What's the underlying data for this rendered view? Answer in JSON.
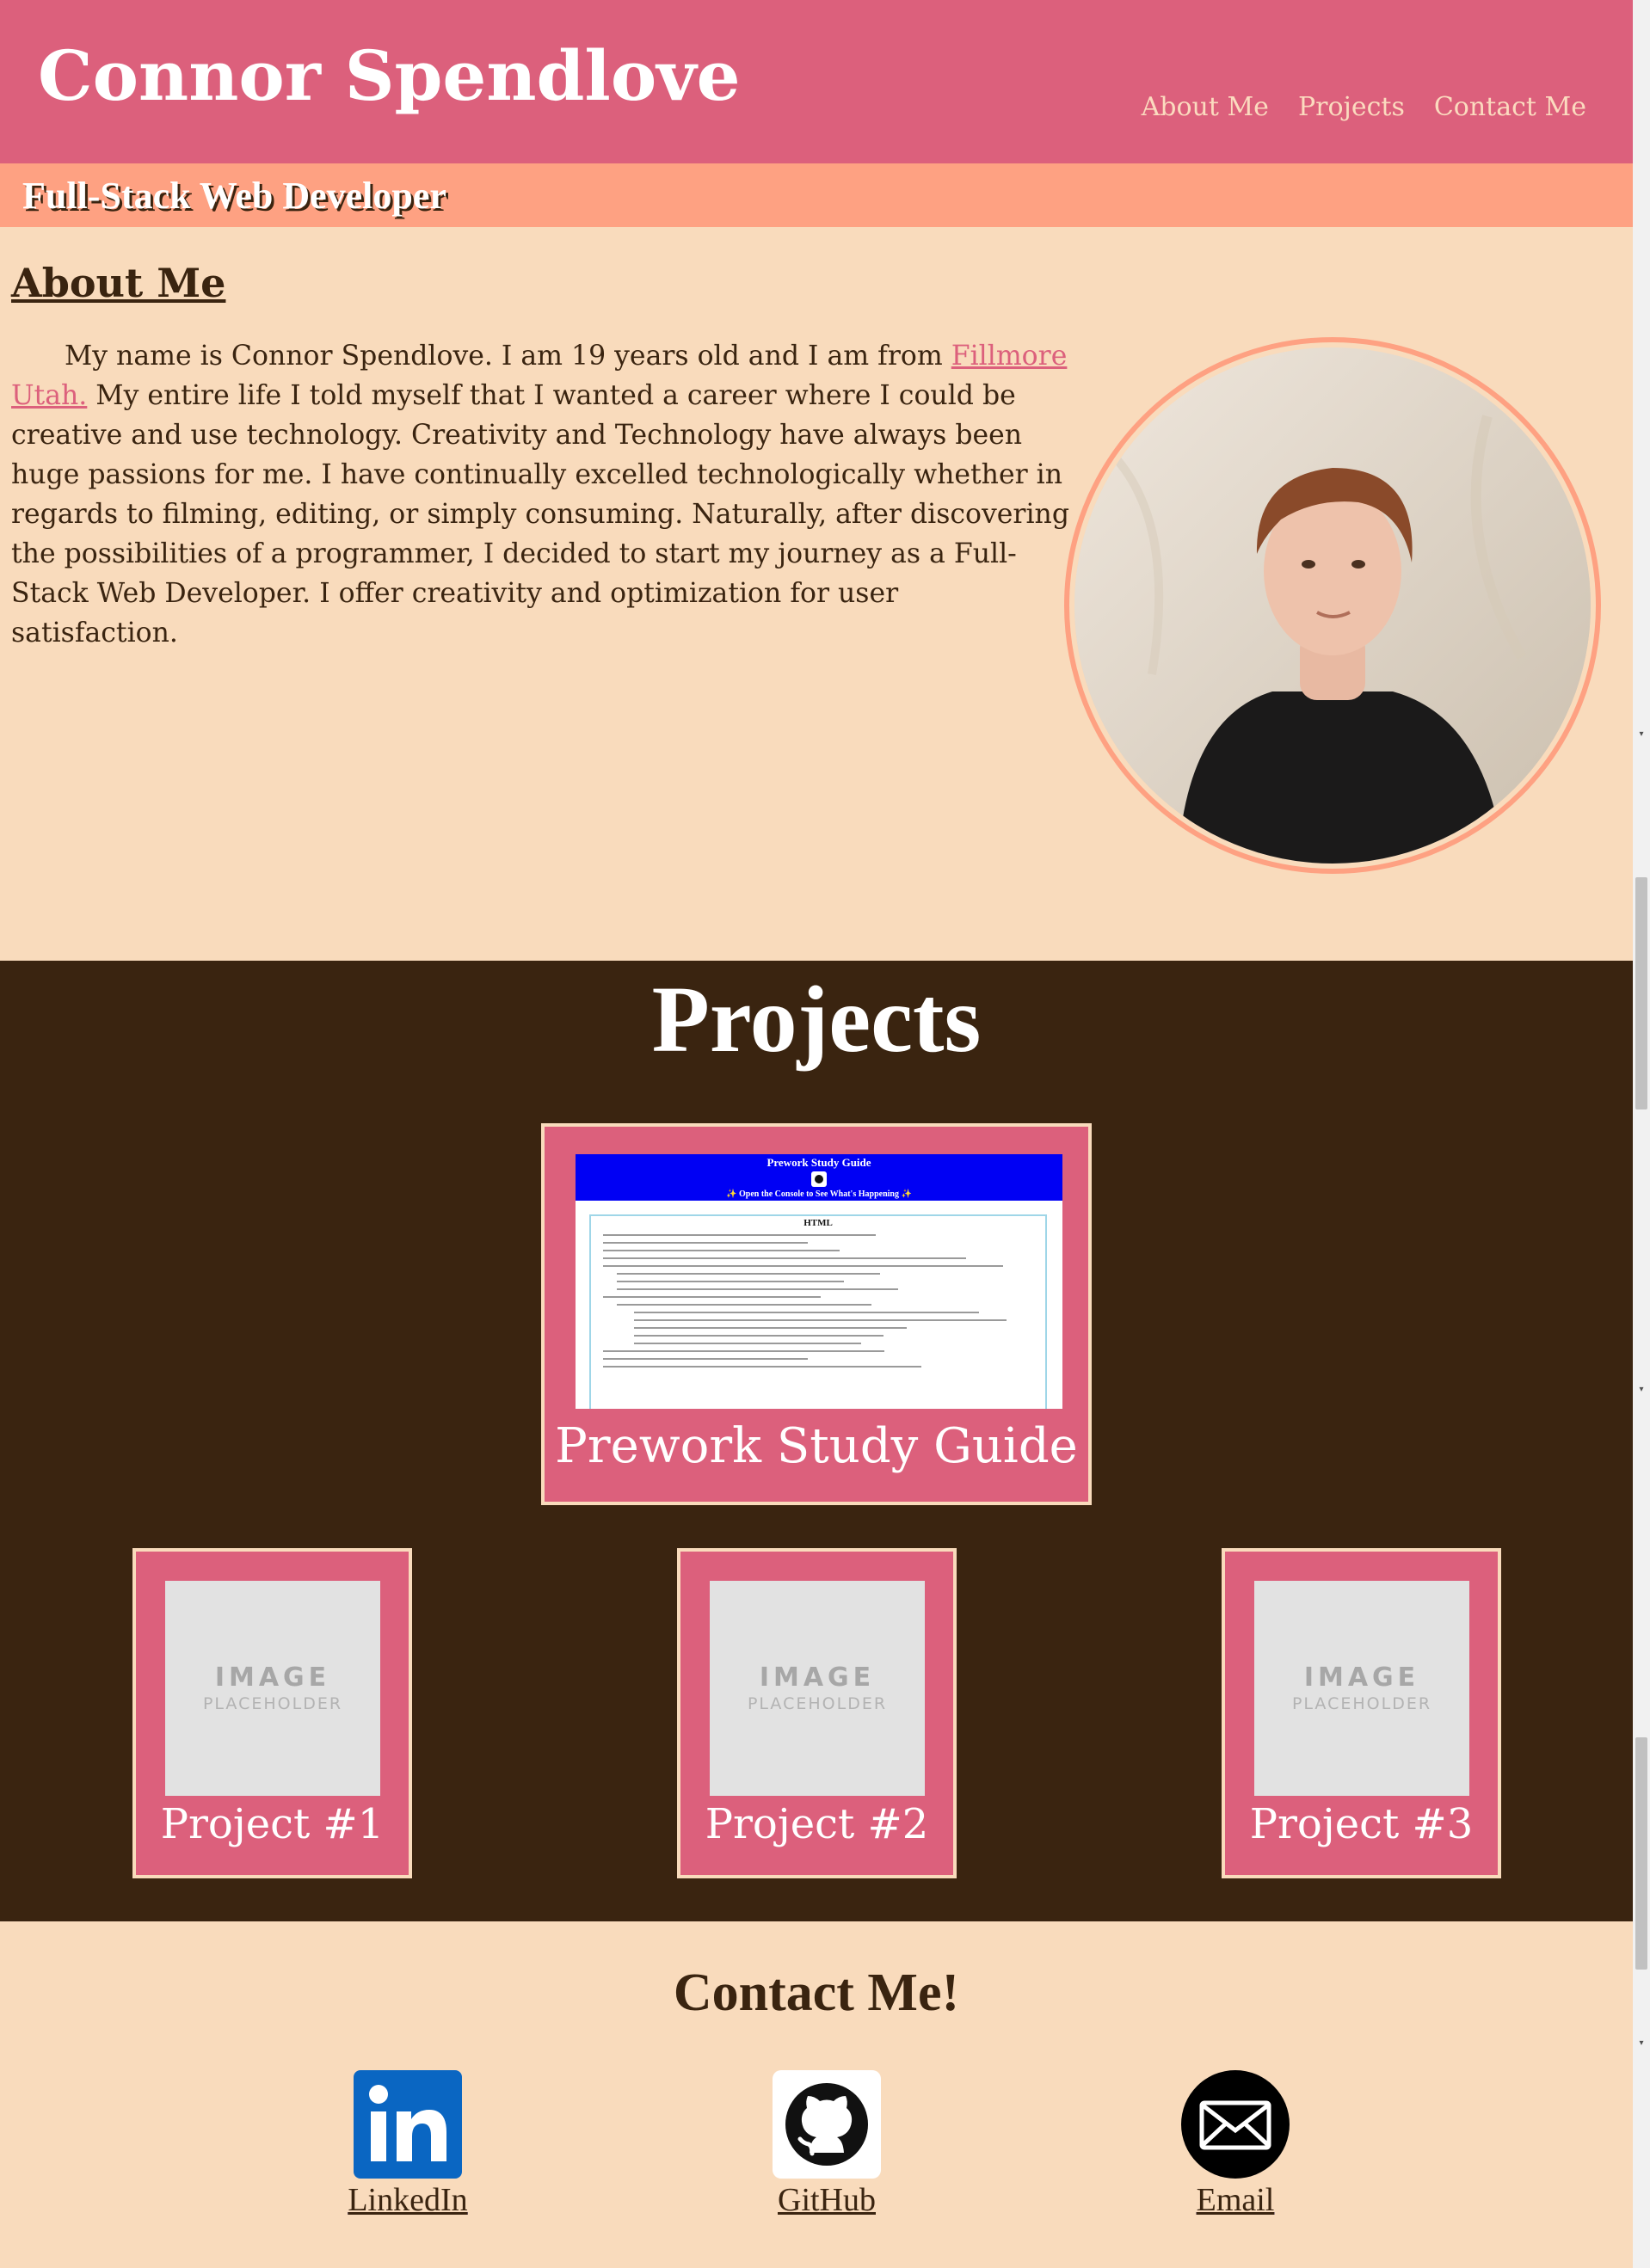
{
  "header": {
    "title": "Connor Spendlove",
    "subtitle": "Full-Stack Web Developer",
    "nav": [
      "About Me",
      "Projects",
      "Contact Me"
    ]
  },
  "about": {
    "heading": "About Me",
    "text_before_link": "My name is Connor Spendlove. I am 19 years old and I am from ",
    "link_text": "Fillmore Utah.",
    "text_after_link": " My entire life I told myself that I wanted a career where I could be creative and use technology. Creativity and Technology have always been huge passions for me. I have continually excelled technologically whether in regards to filming, editing, or simply consuming. Naturally, after discovering the possibilities of a programmer, I decided to start my journey as a Full-Stack Web Developer. I offer creativity and optimization for user satisfaction."
  },
  "projects": {
    "heading": "Projects",
    "featured": {
      "title": "Prework Study Guide",
      "screenshot": {
        "header_title": "Prework Study Guide",
        "console_text": "✨ Open the Console to See What's Happening ✨",
        "section_title": "HTML"
      }
    },
    "placeholder_big": "IMAGE",
    "placeholder_small": "PLACEHOLDER",
    "cards": [
      {
        "title": "Project #1"
      },
      {
        "title": "Project #2"
      },
      {
        "title": "Project #3"
      }
    ]
  },
  "contact": {
    "heading": "Contact Me!",
    "links": [
      {
        "label": "LinkedIn",
        "icon": "linkedin-icon"
      },
      {
        "label": "GitHub",
        "icon": "github-icon"
      },
      {
        "label": "Email",
        "icon": "email-icon"
      }
    ]
  },
  "colors": {
    "header_pink": "#dc607c",
    "subbar_salmon": "#fea182",
    "background_peach": "#f9dbbc",
    "dark_brown": "#3a2410",
    "linkedin_blue": "#0a66c2"
  }
}
